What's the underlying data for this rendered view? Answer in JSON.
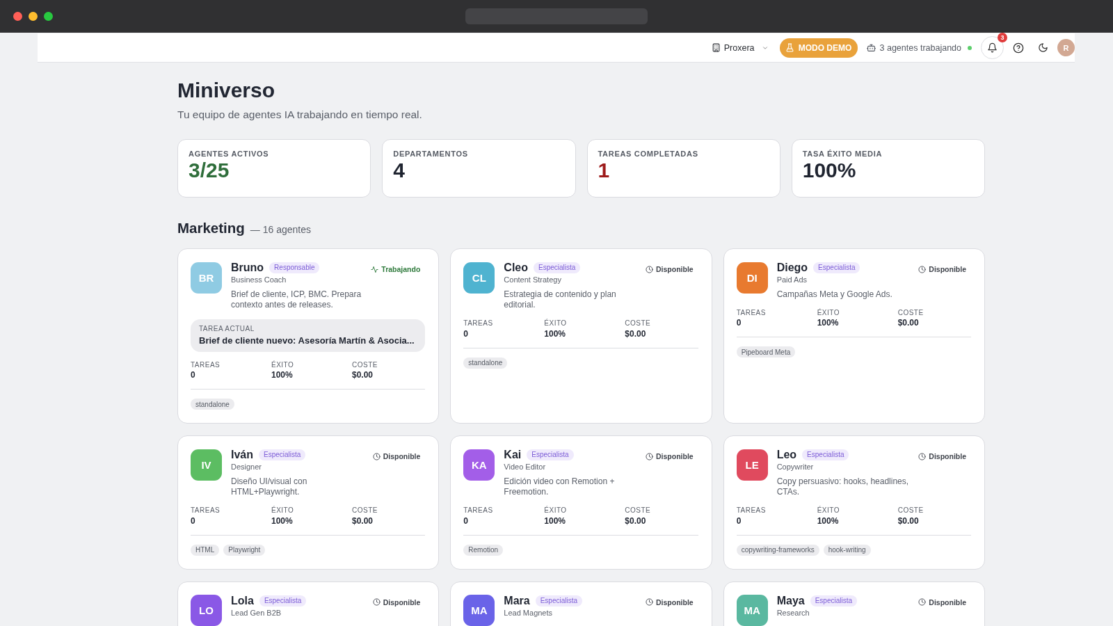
{
  "header": {
    "workspace": {
      "label": "Proxera"
    },
    "demo_button": {
      "label": "MODO DEMO"
    },
    "agents_status": {
      "label": "3 agentes trabajando",
      "live": true
    },
    "notifications": {
      "count": "3"
    },
    "user_avatar": {
      "initial": "R"
    }
  },
  "page": {
    "title": "Miniverso",
    "subtitle": "Tu equipo de agentes IA trabajando en tiempo real."
  },
  "stats": [
    {
      "label": "AGENTES ACTIVOS",
      "value": "3/25",
      "color": "#2f6e3b"
    },
    {
      "label": "DEPARTAMENTOS",
      "value": "4",
      "color": "#1f2430"
    },
    {
      "label": "TAREAS COMPLETADAS",
      "value": "1",
      "color": "#9e1b1b"
    },
    {
      "label": "TASA ÉXITO MEDIA",
      "value": "100%",
      "color": "#1f2430"
    }
  ],
  "section": {
    "title": "Marketing",
    "count": "— 16 agentes"
  },
  "agents": [
    {
      "initials": "BR",
      "color": "#8fcbe3",
      "name": "Bruno",
      "badge": "Responsable",
      "role": "Business Coach",
      "description": "Brief de cliente, ICP, BMC. Prepara contexto antes de releases.",
      "status": {
        "kind": "working",
        "label": "Trabajando"
      },
      "current_task": {
        "label": "TAREA ACTUAL",
        "text": "Brief de cliente nuevo: Asesoría Martín & Asocia..."
      },
      "metrics": [
        {
          "label": "TAREAS",
          "value": "0"
        },
        {
          "label": "ÉXITO",
          "value": "100%"
        },
        {
          "label": "COSTE",
          "value": "$0.00"
        }
      ],
      "tags": [
        "standalone"
      ]
    },
    {
      "initials": "CL",
      "color": "#4fb3d0",
      "name": "Cleo",
      "badge": "Especialista",
      "role": "Content Strategy",
      "description": "Estrategia de contenido y plan editorial.",
      "status": {
        "kind": "available",
        "label": "Disponible"
      },
      "metrics": [
        {
          "label": "TAREAS",
          "value": "0"
        },
        {
          "label": "ÉXITO",
          "value": "100%"
        },
        {
          "label": "COSTE",
          "value": "$0.00"
        }
      ],
      "tags": [
        "standalone"
      ]
    },
    {
      "initials": "DI",
      "color": "#e87a2f",
      "name": "Diego",
      "badge": "Especialista",
      "role": "Paid Ads",
      "description": "Campañas Meta y Google Ads.",
      "status": {
        "kind": "available",
        "label": "Disponible"
      },
      "metrics": [
        {
          "label": "TAREAS",
          "value": "0"
        },
        {
          "label": "ÉXITO",
          "value": "100%"
        },
        {
          "label": "COSTE",
          "value": "$0.00"
        }
      ],
      "tags": [
        "Pipeboard Meta"
      ]
    },
    {
      "initials": "IV",
      "color": "#5cbd62",
      "name": "Iván",
      "badge": "Especialista",
      "role": "Designer",
      "description": "Diseño UI/visual con HTML+Playwright.",
      "status": {
        "kind": "available",
        "label": "Disponible"
      },
      "metrics": [
        {
          "label": "TAREAS",
          "value": "0"
        },
        {
          "label": "ÉXITO",
          "value": "100%"
        },
        {
          "label": "COSTE",
          "value": "$0.00"
        }
      ],
      "tags": [
        "HTML",
        "Playwright"
      ]
    },
    {
      "initials": "KA",
      "color": "#a35ee8",
      "name": "Kai",
      "badge": "Especialista",
      "role": "Video Editor",
      "description": "Edición video con Remotion + Freemotion.",
      "status": {
        "kind": "available",
        "label": "Disponible"
      },
      "metrics": [
        {
          "label": "TAREAS",
          "value": "0"
        },
        {
          "label": "ÉXITO",
          "value": "100%"
        },
        {
          "label": "COSTE",
          "value": "$0.00"
        }
      ],
      "tags": [
        "Remotion"
      ]
    },
    {
      "initials": "LE",
      "color": "#e04a5e",
      "name": "Leo",
      "badge": "Especialista",
      "role": "Copywriter",
      "description": "Copy persuasivo: hooks, headlines, CTAs.",
      "status": {
        "kind": "available",
        "label": "Disponible"
      },
      "metrics": [
        {
          "label": "TAREAS",
          "value": "0"
        },
        {
          "label": "ÉXITO",
          "value": "100%"
        },
        {
          "label": "COSTE",
          "value": "$0.00"
        }
      ],
      "tags": [
        "copywriting-frameworks",
        "hook-writing"
      ]
    },
    {
      "initials": "LO",
      "color": "#8a58e6",
      "name": "Lola",
      "badge": "Especialista",
      "role": "Lead Gen B2B",
      "status": {
        "kind": "available",
        "label": "Disponible"
      }
    },
    {
      "initials": "MA",
      "color": "#6a63e8",
      "name": "Mara",
      "badge": "Especialista",
      "role": "Lead Magnets",
      "status": {
        "kind": "available",
        "label": "Disponible"
      }
    },
    {
      "initials": "MA",
      "color": "#5ab8a0",
      "name": "Maya",
      "badge": "Especialista",
      "role": "Research",
      "status": {
        "kind": "available",
        "label": "Disponible"
      }
    }
  ]
}
